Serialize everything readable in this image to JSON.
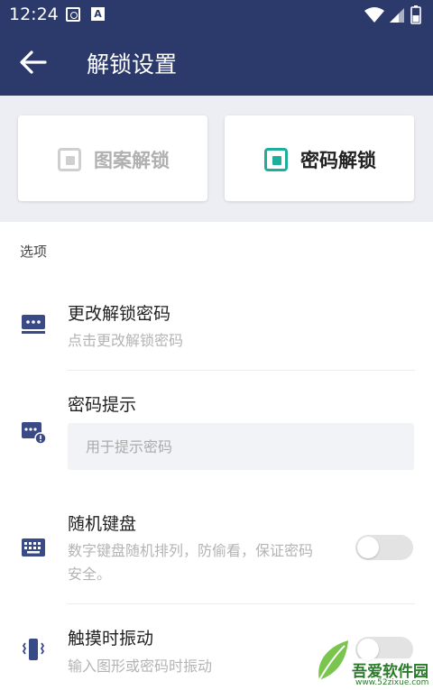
{
  "status_bar": {
    "time": "12:24",
    "icon_left_1": "safe-notification-icon",
    "icon_left_2": "A",
    "icons_right": [
      "wifi-icon",
      "signal-icon",
      "battery-icon"
    ]
  },
  "header": {
    "title": "解锁设置",
    "back_icon": "back-arrow-icon",
    "background": "#2c3a6b"
  },
  "unlock_modes": [
    {
      "label": "图案解锁",
      "selected": false
    },
    {
      "label": "密码解锁",
      "selected": true
    }
  ],
  "accent_color": "#1fae9c",
  "section": {
    "title": "选项"
  },
  "options": {
    "change_password": {
      "title": "更改解锁密码",
      "subtitle": "点击更改解锁密码",
      "icon": "password-card-icon"
    },
    "password_hint": {
      "title": "密码提示",
      "placeholder": "用于提示密码",
      "value": "",
      "icon": "password-alert-icon"
    },
    "random_keyboard": {
      "title": "随机键盘",
      "subtitle_line1": "数字键盘随机排列，防偷看，保证密码",
      "subtitle_line2": "安全。",
      "icon": "keyboard-icon",
      "enabled": false
    },
    "touch_vibrate": {
      "title": "触摸时振动",
      "subtitle": "输入图形或密码时振动",
      "icon": "vibrate-phone-icon",
      "enabled": false
    }
  },
  "watermark": {
    "brand": "吾爱软件园",
    "url": "www.52zixue.com"
  }
}
